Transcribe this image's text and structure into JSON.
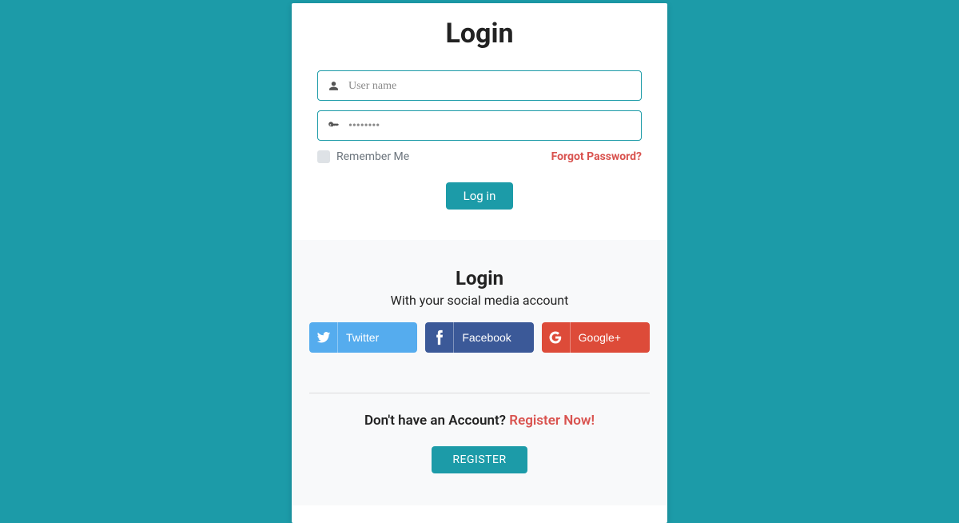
{
  "header": {
    "title": "Login"
  },
  "fields": {
    "username": {
      "placeholder": "User name",
      "value": ""
    },
    "password": {
      "placeholder": "••••••••",
      "value": ""
    }
  },
  "remember": {
    "label": "Remember Me"
  },
  "forgot": {
    "label": "Forgot Password?"
  },
  "login_button": {
    "label": "Log in"
  },
  "social": {
    "title": "Login",
    "tagline": "With your social media account",
    "buttons": {
      "twitter": "Twitter",
      "facebook": "Facebook",
      "google": "Google+"
    }
  },
  "register": {
    "prompt": "Don't have an Account? ",
    "link": "Register Now!",
    "button": "REGISTER"
  }
}
